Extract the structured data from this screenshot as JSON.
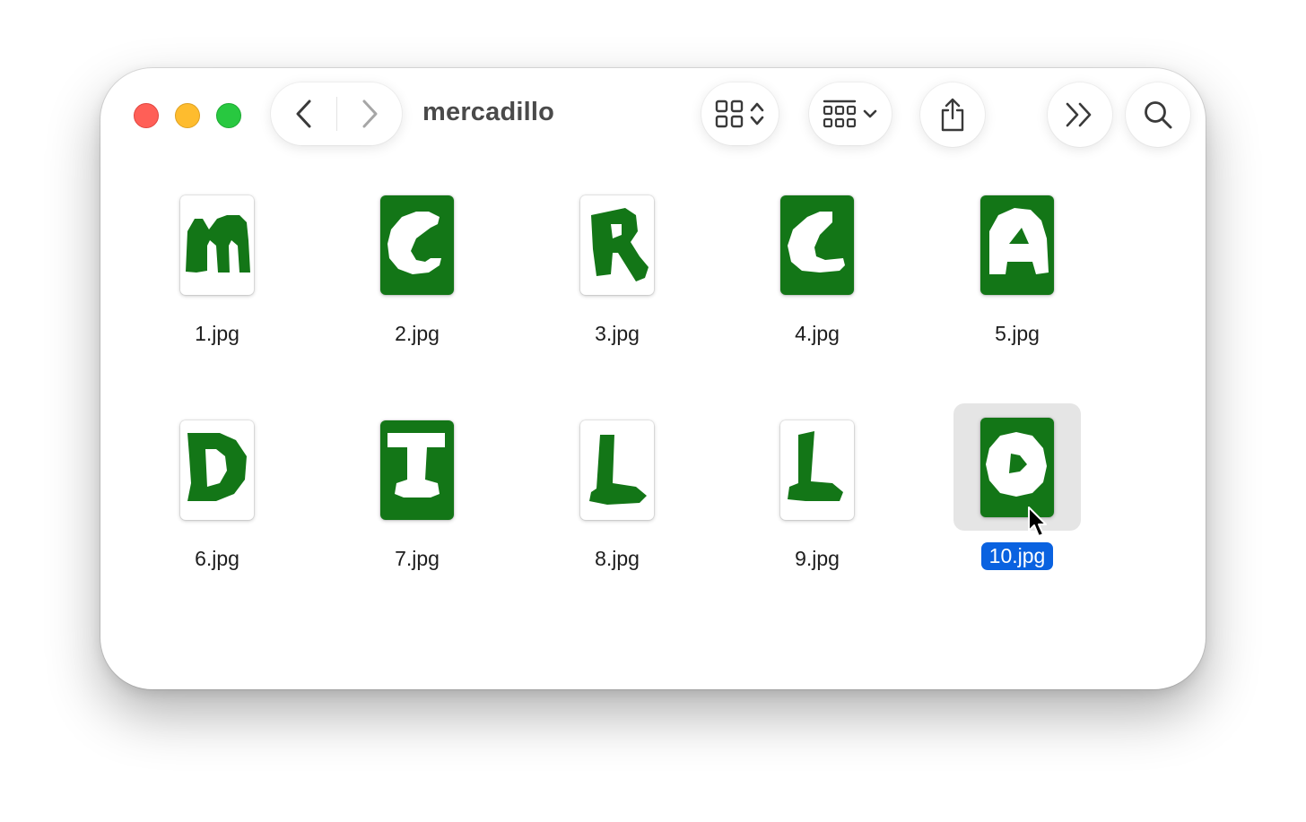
{
  "window": {
    "title": "mercadillo",
    "traffic_lights": [
      "close",
      "minimize",
      "zoom"
    ]
  },
  "toolbar": {
    "back": "chevron-left-icon",
    "forward": "chevron-right-icon",
    "view_mode": "icon-grid-icon",
    "group": "group-by-icon",
    "share": "share-icon",
    "more": "double-chevron-right-icon",
    "search": "search-icon"
  },
  "files": [
    {
      "name": "1.jpg",
      "letter": "M",
      "bg": "white"
    },
    {
      "name": "2.jpg",
      "letter": "C",
      "bg": "green"
    },
    {
      "name": "3.jpg",
      "letter": "R",
      "bg": "white"
    },
    {
      "name": "4.jpg",
      "letter": "C",
      "bg": "green"
    },
    {
      "name": "5.jpg",
      "letter": "A",
      "bg": "green"
    },
    {
      "name": "6.jpg",
      "letter": "D",
      "bg": "white"
    },
    {
      "name": "7.jpg",
      "letter": "I",
      "bg": "green"
    },
    {
      "name": "8.jpg",
      "letter": "L",
      "bg": "white"
    },
    {
      "name": "9.jpg",
      "letter": "L",
      "bg": "white"
    },
    {
      "name": "10.jpg",
      "letter": "O",
      "bg": "green",
      "selected": true
    }
  ],
  "colors": {
    "accent": "#0a62e0",
    "green": "#137617",
    "close": "#ff5f57",
    "minimize": "#febc2e",
    "zoom": "#28c840"
  }
}
